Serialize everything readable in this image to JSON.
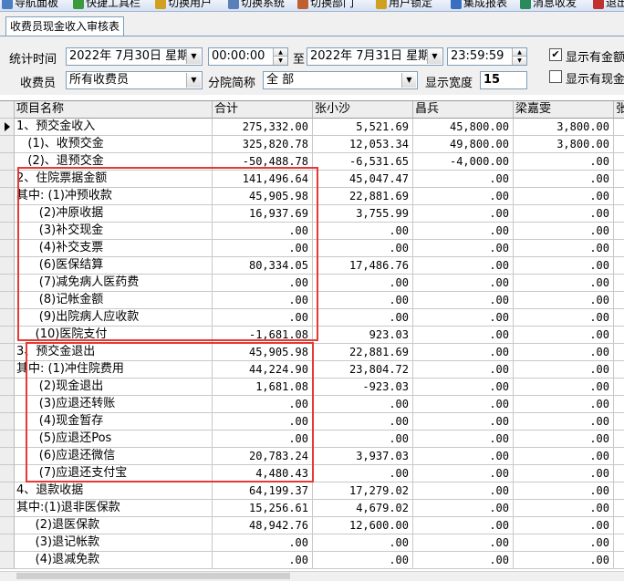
{
  "toolbar": {
    "items": [
      {
        "label": "导航面板",
        "icon": "navigation-panel-icon",
        "color": "#4a7fc1"
      },
      {
        "label": "快捷工具栏",
        "icon": "shortcut-toolbar-icon",
        "color": "#3c9a3c"
      },
      {
        "label": "切换用户",
        "icon": "switch-user-icon",
        "color": "#d0a020"
      },
      {
        "label": "切换系统",
        "icon": "switch-system-icon",
        "color": "#5b7fb8"
      },
      {
        "label": "切换部门",
        "icon": "switch-department-icon",
        "color": "#c06030"
      },
      {
        "label": "用户锁定",
        "icon": "user-lock-icon",
        "color": "#d0a020"
      },
      {
        "label": "集成报表",
        "icon": "integrated-report-icon",
        "color": "#3a6ec0"
      },
      {
        "label": "消息收发",
        "icon": "message-icon",
        "color": "#2a8a5a"
      },
      {
        "label": "退出",
        "icon": "exit-icon",
        "color": "#c03030"
      }
    ]
  },
  "tab": {
    "title": "收费员现金收入审核表"
  },
  "filters": {
    "date_label": "统计时间",
    "start_date": "2022年 7月30日 星期",
    "start_time": "00:00:00",
    "to_label": "至",
    "end_date": "2022年 7月31日 星期",
    "end_time": "23:59:59",
    "cashier_label": "收费员",
    "cashier_value": "所有收费员",
    "branch_label": "分院简称",
    "branch_value": "全 部",
    "width_label": "显示宽度",
    "width_value": "15",
    "check1_label": "显示有金额",
    "check1_checked": true,
    "check2_label": "显示有现金",
    "check2_checked": false
  },
  "table": {
    "columns": [
      "项目名称",
      "合计",
      "张小沙",
      "昌兵",
      "梁嘉雯",
      "张"
    ],
    "rows": [
      {
        "name": "1、预交金收入",
        "values": [
          "275,332.00",
          "5,521.69",
          "45,800.00",
          "3,800.00",
          ""
        ]
      },
      {
        "name": "   (1)、收预交金",
        "values": [
          "325,820.78",
          "12,053.34",
          "49,800.00",
          "3,800.00",
          ""
        ]
      },
      {
        "name": "   (2)、退预交金",
        "values": [
          "-50,488.78",
          "-6,531.65",
          "-4,000.00",
          ".00",
          ""
        ]
      },
      {
        "name": "2、住院票据金额",
        "values": [
          "141,496.64",
          "45,047.47",
          ".00",
          ".00",
          ""
        ]
      },
      {
        "name": "其中: (1)冲预收款",
        "values": [
          "45,905.98",
          "22,881.69",
          ".00",
          ".00",
          ""
        ]
      },
      {
        "name": "      (2)冲原收据",
        "values": [
          "16,937.69",
          "3,755.99",
          ".00",
          ".00",
          ""
        ]
      },
      {
        "name": "      (3)补交现金",
        "values": [
          ".00",
          ".00",
          ".00",
          ".00",
          ""
        ]
      },
      {
        "name": "      (4)补交支票",
        "values": [
          ".00",
          ".00",
          ".00",
          ".00",
          ""
        ]
      },
      {
        "name": "      (6)医保结算",
        "values": [
          "80,334.05",
          "17,486.76",
          ".00",
          ".00",
          ""
        ]
      },
      {
        "name": "      (7)减免病人医药费",
        "values": [
          ".00",
          ".00",
          ".00",
          ".00",
          ""
        ]
      },
      {
        "name": "      (8)记帐金额",
        "values": [
          ".00",
          ".00",
          ".00",
          ".00",
          ""
        ]
      },
      {
        "name": "      (9)出院病人应收款",
        "values": [
          ".00",
          ".00",
          ".00",
          ".00",
          ""
        ]
      },
      {
        "name": "     (10)医院支付",
        "values": [
          "-1,681.08",
          "923.03",
          ".00",
          ".00",
          ""
        ]
      },
      {
        "name": "3、预交金退出",
        "values": [
          "45,905.98",
          "22,881.69",
          ".00",
          ".00",
          ""
        ]
      },
      {
        "name": "其中: (1)冲住院费用",
        "values": [
          "44,224.90",
          "23,804.72",
          ".00",
          ".00",
          ""
        ]
      },
      {
        "name": "      (2)现金退出",
        "values": [
          "1,681.08",
          "-923.03",
          ".00",
          ".00",
          ""
        ]
      },
      {
        "name": "      (3)应退还转账",
        "values": [
          ".00",
          ".00",
          ".00",
          ".00",
          ""
        ]
      },
      {
        "name": "      (4)现金暂存",
        "values": [
          ".00",
          ".00",
          ".00",
          ".00",
          ""
        ]
      },
      {
        "name": "      (5)应退还Pos",
        "values": [
          ".00",
          ".00",
          ".00",
          ".00",
          ""
        ]
      },
      {
        "name": "      (6)应退还微信",
        "values": [
          "20,783.24",
          "3,937.03",
          ".00",
          ".00",
          ""
        ]
      },
      {
        "name": "      (7)应退还支付宝",
        "values": [
          "4,480.43",
          ".00",
          ".00",
          ".00",
          ""
        ]
      },
      {
        "name": "4、退款收据",
        "values": [
          "64,199.37",
          "17,279.02",
          ".00",
          ".00",
          ""
        ]
      },
      {
        "name": "其中:(1)退非医保款",
        "values": [
          "15,256.61",
          "4,679.02",
          ".00",
          ".00",
          ""
        ]
      },
      {
        "name": "     (2)退医保款",
        "values": [
          "48,942.76",
          "12,600.00",
          ".00",
          ".00",
          ""
        ]
      },
      {
        "name": "     (3)退记帐款",
        "values": [
          ".00",
          ".00",
          ".00",
          ".00",
          ""
        ]
      },
      {
        "name": "     (4)退减免款",
        "values": [
          ".00",
          ".00",
          ".00",
          ".00",
          ""
        ]
      }
    ]
  },
  "colors": {
    "highlight": "#e53935",
    "header_bg": "#eeeeee",
    "grid_line": "#c8c8c8"
  }
}
